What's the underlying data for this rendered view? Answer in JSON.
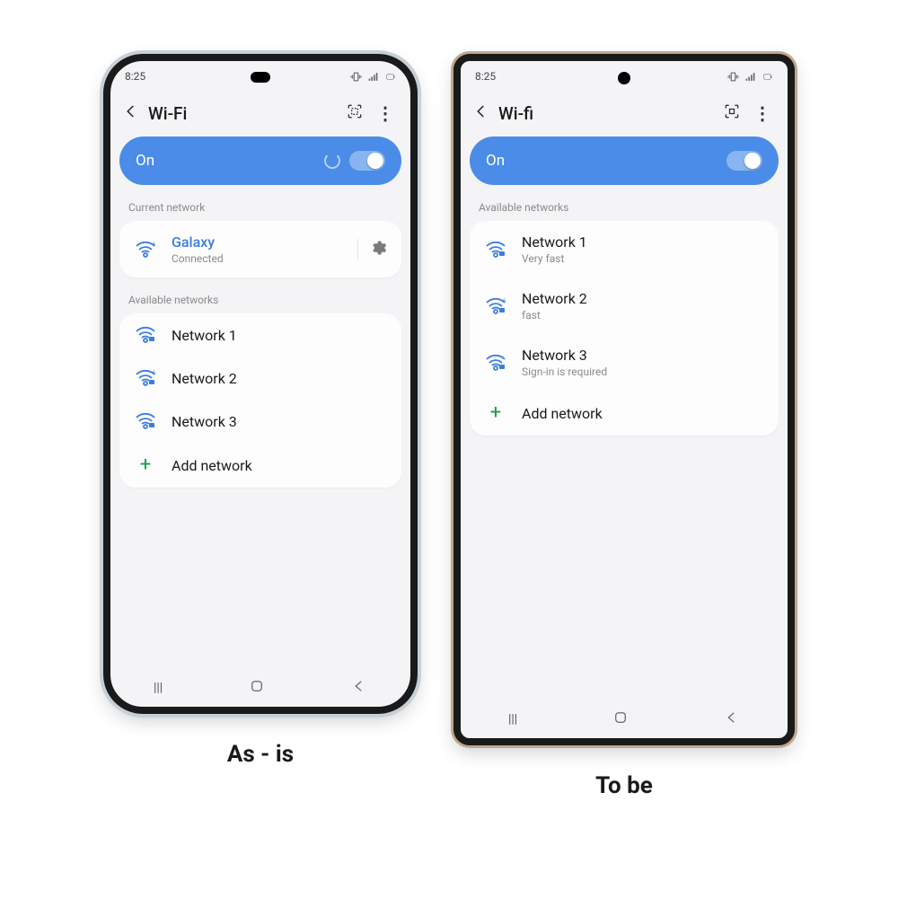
{
  "captions": {
    "left": "As - is",
    "right": "To be"
  },
  "status": {
    "time": "8:25"
  },
  "left": {
    "title": "Wi-Fi",
    "toggle_label": "On",
    "show_spinner": true,
    "section_current": "Current network",
    "current": {
      "name": "Galaxy",
      "sub": "Connected"
    },
    "section_available": "Available networks",
    "networks": [
      {
        "name": "Network 1",
        "sub": ""
      },
      {
        "name": "Network 2",
        "sub": ""
      },
      {
        "name": "Network 3",
        "sub": ""
      }
    ],
    "add": "Add network"
  },
  "right": {
    "title": "Wi-fi",
    "toggle_label": "On",
    "section_available": "Available networks",
    "networks": [
      {
        "name": "Network 1",
        "sub": "Very fast"
      },
      {
        "name": "Network 2",
        "sub": "fast"
      },
      {
        "name": "Network 3",
        "sub": "Sign-in is required"
      }
    ],
    "add": "Add network"
  }
}
